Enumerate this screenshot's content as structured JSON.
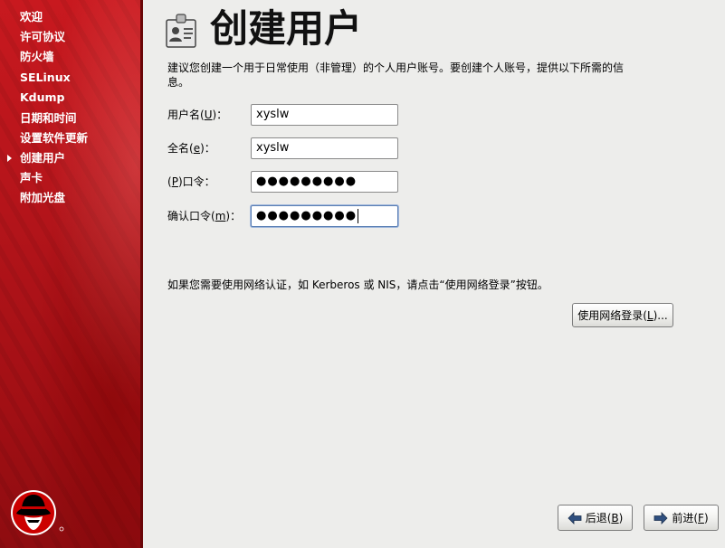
{
  "sidebar": {
    "steps": [
      {
        "label": "欢迎",
        "current": false
      },
      {
        "label": "许可协议",
        "current": false
      },
      {
        "label": "防火墙",
        "current": false
      },
      {
        "label": "SELinux",
        "current": false
      },
      {
        "label": "Kdump",
        "current": false
      },
      {
        "label": "日期和时间",
        "current": false
      },
      {
        "label": "设置软件更新",
        "current": false
      },
      {
        "label": "创建用户",
        "current": true
      },
      {
        "label": "声卡",
        "current": false
      },
      {
        "label": "附加光盘",
        "current": false
      }
    ],
    "logo_icon": "red-hat-shadowman-icon"
  },
  "main": {
    "header_icon": "user-id-card-icon",
    "title": "创建用户",
    "intro": "建议您创建一个用于日常使用（非管理）的个人用户账号。要创建个人账号，提供以下所需的信息。",
    "fields": {
      "username": {
        "label_pre": "用户名(",
        "mnemonic": "U",
        "label_post": ")：",
        "value": "xyslw"
      },
      "fullname": {
        "label_pre": "全名(",
        "mnemonic": "e",
        "label_post": ")：",
        "value": "xyslw"
      },
      "password": {
        "label_pre": "(",
        "mnemonic": "P",
        "label_post": ")口令：",
        "value": "●●●●●●●●●"
      },
      "confirm": {
        "label_pre": "确认口令(",
        "mnemonic": "m",
        "label_post": ")：",
        "value": "●●●●●●●●●"
      }
    },
    "network_note": "如果您需要使用网络认证，如 Kerberos 或 NIS，请点击“使用网络登录”按钮。",
    "network_button": {
      "label_pre": "使用网络登录(",
      "mnemonic": "L",
      "label_post": ")..."
    }
  },
  "nav": {
    "back": {
      "label_pre": "后退(",
      "mnemonic": "B",
      "label_post": ")",
      "icon": "arrow-left-icon"
    },
    "next": {
      "label_pre": "前进(",
      "mnemonic": "F",
      "label_post": ")",
      "icon": "arrow-right-icon"
    }
  },
  "colors": {
    "sidebar_red": "#b3141a",
    "background": "#ededeb",
    "focus_border": "#5b7fb4"
  }
}
